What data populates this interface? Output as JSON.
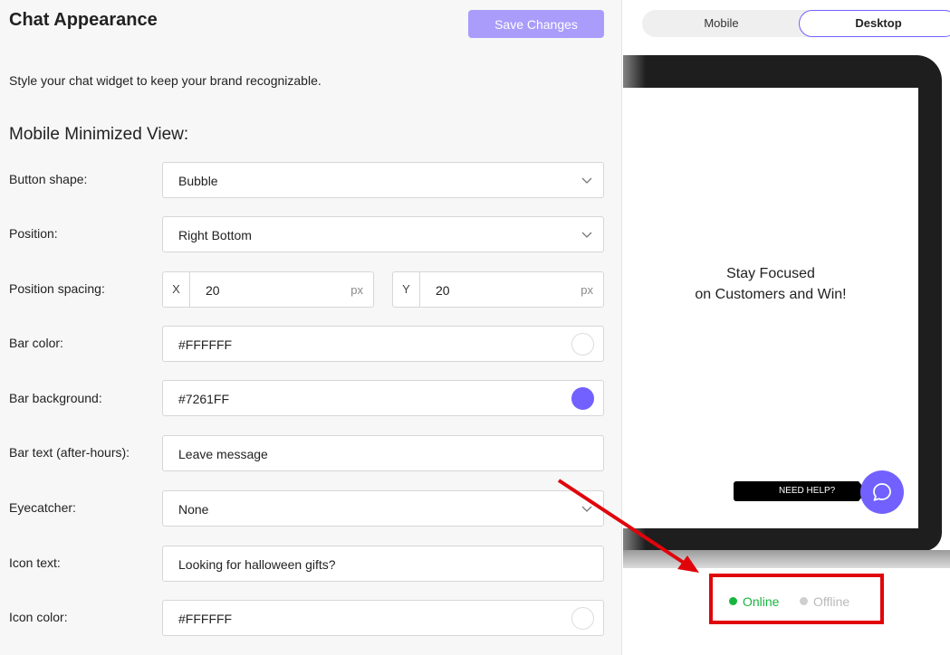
{
  "header": {
    "title": "Chat Appearance",
    "save_label": "Save Changes",
    "subtitle": "Style your chat widget to keep your brand recognizable."
  },
  "section": {
    "title": "Mobile Minimized View:"
  },
  "fields": {
    "button_shape": {
      "label": "Button shape:",
      "value": "Bubble"
    },
    "position": {
      "label": "Position:",
      "value": "Right Bottom"
    },
    "position_spacing": {
      "label": "Position spacing:",
      "x_label": "X",
      "x_value": "20",
      "y_label": "Y",
      "y_value": "20",
      "unit": "px"
    },
    "bar_color": {
      "label": "Bar color:",
      "value": "#FFFFFF",
      "swatch": "#FFFFFF"
    },
    "bar_background": {
      "label": "Bar background:",
      "value": "#7261FF",
      "swatch": "#7261FF"
    },
    "bar_text": {
      "label": "Bar text (after-hours):",
      "value": "Leave message"
    },
    "eyecatcher": {
      "label": "Eyecatcher:",
      "value": "None"
    },
    "icon_text": {
      "label": "Icon text:",
      "value": "Looking for halloween gifts?"
    },
    "icon_color": {
      "label": "Icon color:",
      "value": "#FFFFFF",
      "swatch": "#FFFFFF"
    }
  },
  "preview": {
    "tabs": {
      "mobile": "Mobile",
      "desktop": "Desktop",
      "selected": "Desktop"
    },
    "hero_line1": "Stay Focused",
    "hero_line2": "on Customers and Win!",
    "need_help": "NEED HELP?",
    "chat_icon": "chat-bubble-icon",
    "status_online": "Online",
    "status_offline": "Offline"
  },
  "colors": {
    "accent": "#7261FF",
    "save_button": "#A99CFB",
    "online": "#17B53F",
    "offline": "#B9B9B9",
    "annotation": "#E0050B"
  }
}
